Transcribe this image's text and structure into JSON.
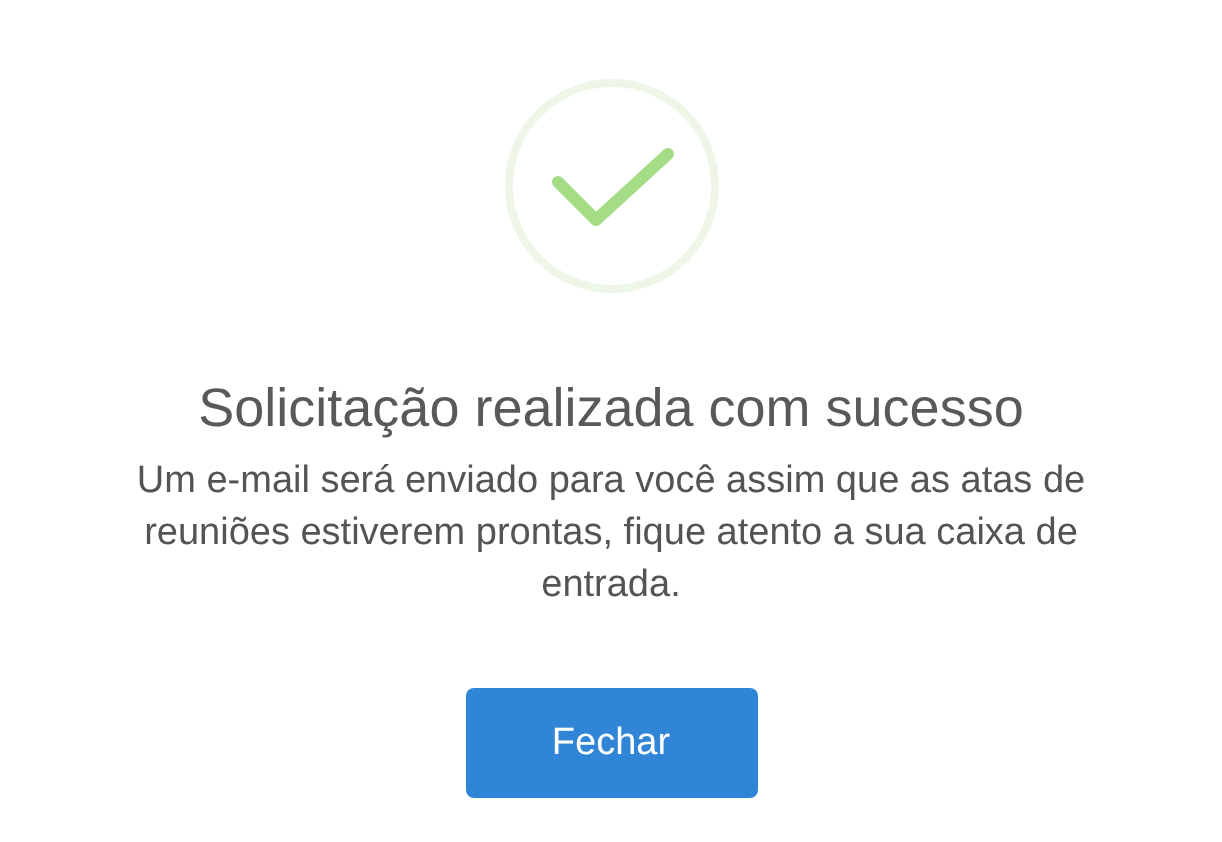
{
  "dialog": {
    "icon": {
      "kind": "success"
    },
    "title": "Solicitação realizada com sucesso",
    "message": "Um e-mail será enviado para você assim que as atas de reuniões estiverem prontas, fique atento a sua caixa de entrada.",
    "buttons": [
      {
        "label": "Fechar"
      }
    ]
  }
}
